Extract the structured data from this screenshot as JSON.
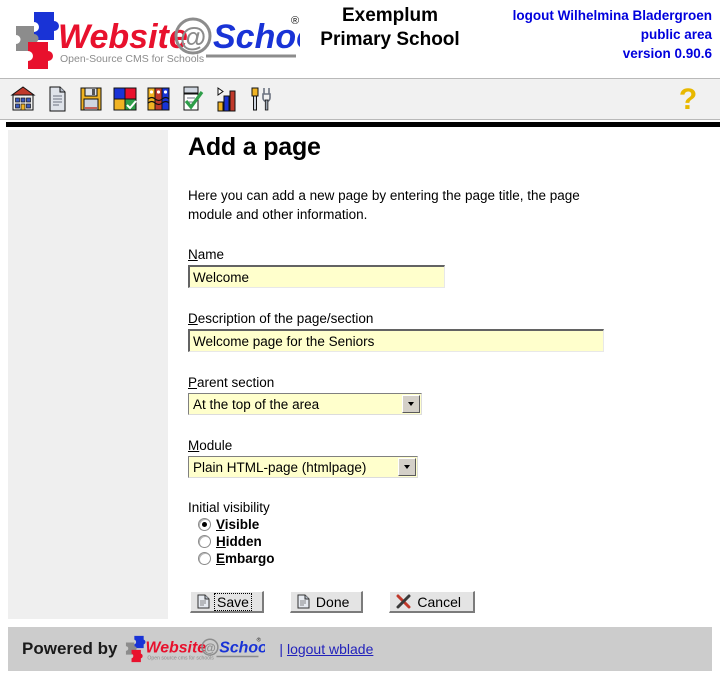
{
  "header": {
    "logo_alt": "Website@School",
    "logo_text_1": "Website",
    "logo_at": "@",
    "logo_text_2": "School",
    "logo_tagline": "Open-Source CMS for Schools",
    "logo_registered": "®",
    "school_name_line1": "Exemplum",
    "school_name_line2": "Primary School",
    "logout_label": "logout Wilhelmina Bladergroen",
    "area_label": "public area",
    "version_label": "version 0.90.6"
  },
  "toolbar": {
    "icons": [
      {
        "name": "school-icon",
        "title": "School"
      },
      {
        "name": "page-icon",
        "title": "Pages"
      },
      {
        "name": "save-icon",
        "title": "Save"
      },
      {
        "name": "modules-icon",
        "title": "Modules"
      },
      {
        "name": "users-icon",
        "title": "Users"
      },
      {
        "name": "tasks-icon",
        "title": "Tasks"
      },
      {
        "name": "statistics-icon",
        "title": "Statistics"
      },
      {
        "name": "tools-icon",
        "title": "Tools"
      }
    ],
    "help_icon": "help-question-icon",
    "help_label": "?"
  },
  "main": {
    "title": "Add a page",
    "intro": "Here you can add a new page by entering the page title, the page module and other information.",
    "fields": {
      "name": {
        "label_accesskey": "N",
        "label_rest": "ame",
        "value": "Welcome",
        "placeholder": ""
      },
      "description": {
        "label_accesskey": "D",
        "label_rest": "escription of the page/section",
        "value": "Welcome page for the Seniors",
        "placeholder": ""
      },
      "parent_section": {
        "label_accesskey": "P",
        "label_rest": "arent section",
        "value": "At the top of the area",
        "options": [
          "At the top of the area"
        ]
      },
      "module": {
        "label_accesskey": "M",
        "label_rest": "odule",
        "value": "Plain HTML-page (htmlpage)",
        "options": [
          "Plain HTML-page (htmlpage)"
        ]
      },
      "visibility": {
        "label": "Initial visibility",
        "selected": "Visible",
        "options": [
          {
            "accesskey": "V",
            "rest": "isible",
            "checked": true
          },
          {
            "accesskey": "H",
            "rest": "idden",
            "checked": false
          },
          {
            "accesskey": "E",
            "rest": "mbargo",
            "checked": false
          }
        ]
      }
    },
    "buttons": [
      {
        "name": "save-button",
        "label": "Save",
        "icon": "document-icon",
        "focused": true
      },
      {
        "name": "done-button",
        "label": "Done",
        "icon": "document-icon",
        "focused": false
      },
      {
        "name": "cancel-button",
        "label": "Cancel",
        "icon": "cancel-cross-icon",
        "focused": false
      }
    ]
  },
  "footer": {
    "powered_by": "Powered by",
    "logo_text_1": "Website",
    "logo_at": "@",
    "logo_text_2": "School",
    "logo_tagline": "Open source cms for schools",
    "separator": "|",
    "logout_link": "logout wblade"
  },
  "colors": {
    "input_background": "#ffffcc",
    "link_blue": "#0000dd",
    "sidebar_gray": "#efefef",
    "footer_gray": "#cccccc",
    "logo_red": "#e8112d",
    "logo_blue": "#1933d6",
    "help_gold": "#e8b800"
  }
}
